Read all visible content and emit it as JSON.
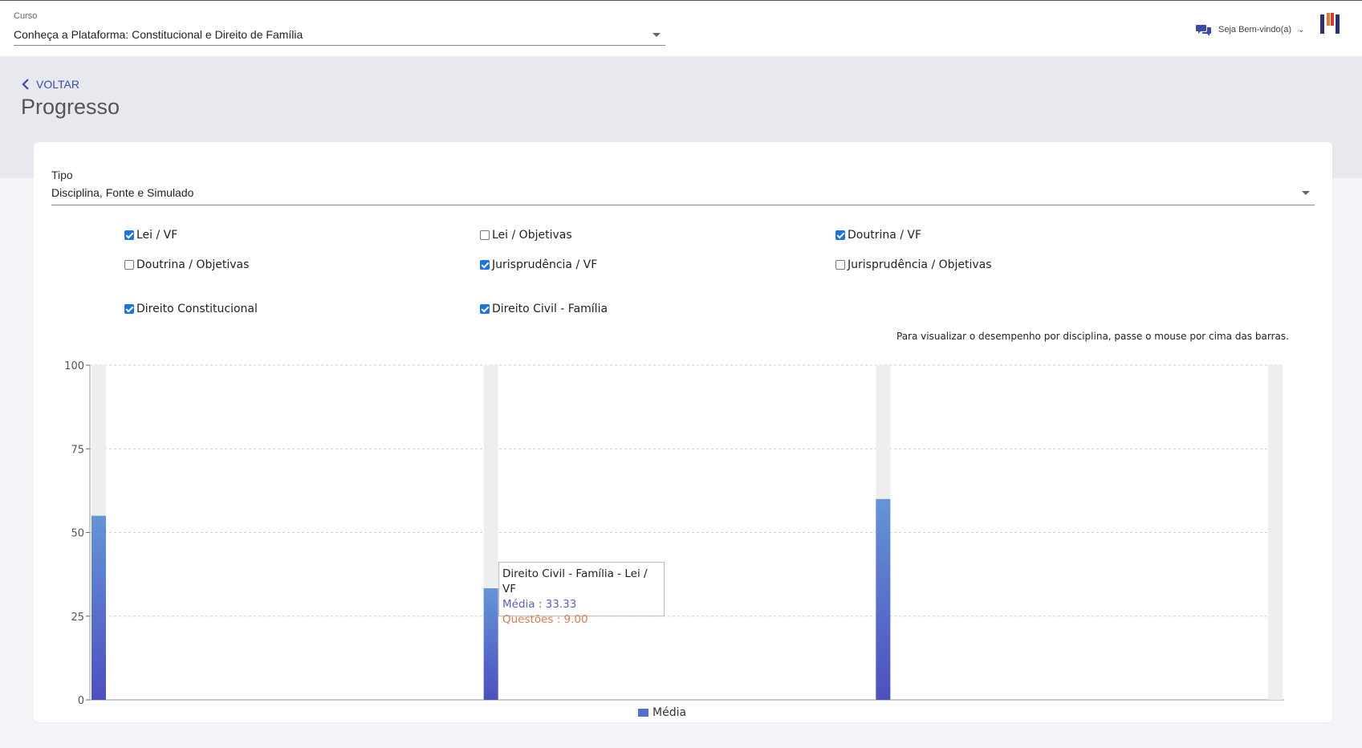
{
  "topbar": {
    "course_label": "Curso",
    "course_value": "Conheça a Plataforma: Constitucional e Direito de Família",
    "welcome": "Seja Bem-vindo(a)"
  },
  "header": {
    "back_label": "VOLTAR",
    "title": "Progresso"
  },
  "filters": {
    "tipo_label": "Tipo",
    "tipo_value": "Disciplina, Fonte e Simulado",
    "checkboxes": [
      {
        "label": "Lei / VF",
        "checked": true
      },
      {
        "label": "Lei / Objetivas",
        "checked": false
      },
      {
        "label": "Doutrina / VF",
        "checked": true
      },
      {
        "label": "Doutrina / Objetivas",
        "checked": false
      },
      {
        "label": "Jurisprudência / VF",
        "checked": true
      },
      {
        "label": "Jurisprudência / Objetivas",
        "checked": false
      },
      {
        "label": "Direito Constitucional",
        "checked": true
      },
      {
        "label": "Direito Civil - Família",
        "checked": true
      }
    ],
    "hint": "Para visualizar o desempenho por disciplina, passe o mouse por cima das barras."
  },
  "chart_data": {
    "type": "bar",
    "ylim": [
      0,
      100
    ],
    "yticks": [
      "0",
      "25",
      "50",
      "75",
      "100"
    ],
    "grid": true,
    "series": [
      {
        "name": "Média",
        "values": [
          55,
          33.33,
          60,
          0
        ]
      }
    ],
    "colors": {
      "bar_top": "#6495d6",
      "bar_bottom": "#4d4fc0",
      "track": "#eeeeee"
    },
    "legend": "bottom"
  },
  "tooltip": {
    "title": "Direito Civil - Família - Lei / VF",
    "media": "Média : 33.33",
    "questoes": "Questões : 9.00"
  },
  "legend": {
    "label": "Média"
  }
}
